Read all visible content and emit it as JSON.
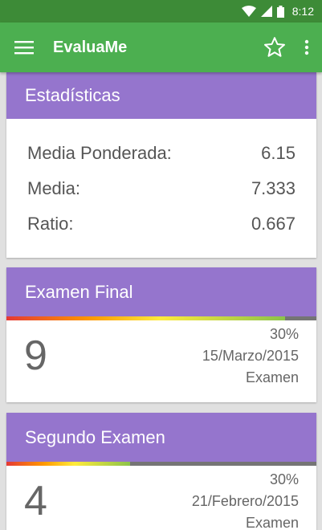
{
  "status_bar": {
    "time": "8:12"
  },
  "app_bar": {
    "title": "EvaluaMe",
    "menu_icon": "hamburger-menu-icon",
    "star_icon": "star-outline-icon",
    "more_icon": "more-vertical-icon"
  },
  "stats": {
    "title": "Estadísticas",
    "rows": [
      {
        "label": "Media Ponderada:",
        "value": "6.15"
      },
      {
        "label": "Media:",
        "value": "7.333"
      },
      {
        "label": "Ratio:",
        "value": "0.667"
      }
    ]
  },
  "exams": [
    {
      "title": "Examen Final",
      "grade": "9",
      "percent": "30%",
      "date": "15/Marzo/2015",
      "type": "Examen",
      "progress": 0.9
    },
    {
      "title": "Segundo Examen",
      "grade": "4",
      "percent": "30%",
      "date": "21/Febrero/2015",
      "type": "Examen",
      "progress": 0.4
    }
  ],
  "colors": {
    "status_bar": "#3d8b37",
    "app_bar": "#4caf50",
    "card_header": "#9575cd",
    "background": "#e0e0e0"
  }
}
